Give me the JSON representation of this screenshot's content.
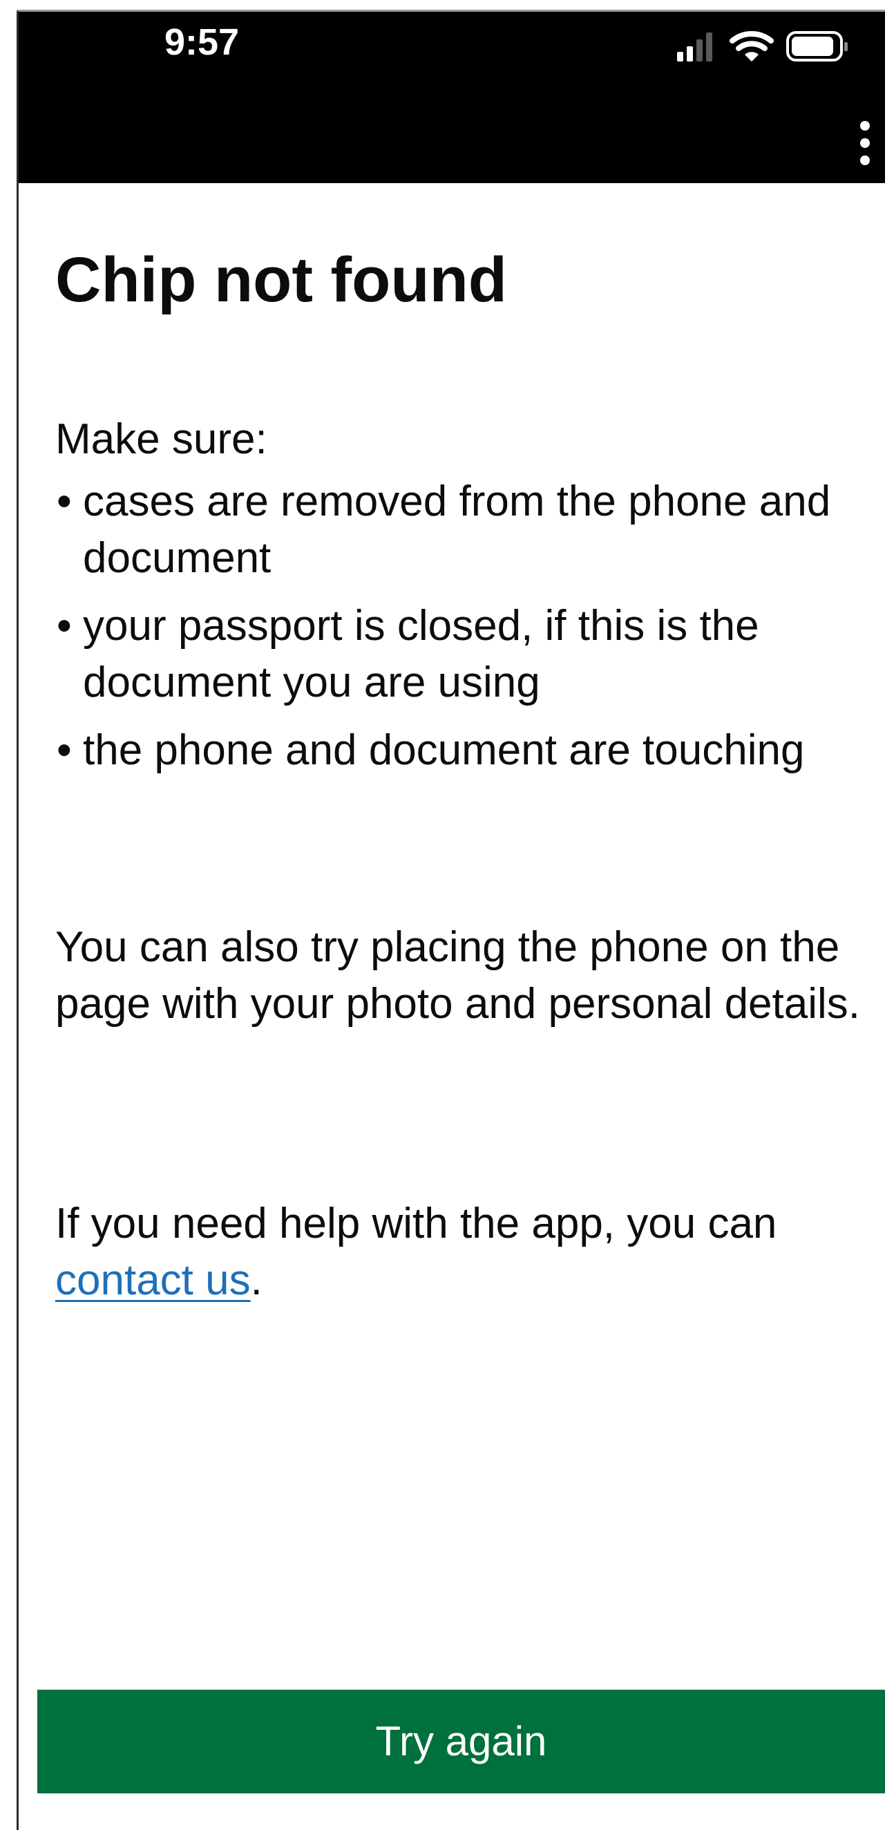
{
  "status_bar": {
    "time": "9:57"
  },
  "icons": {
    "signal": "cellular-signal-icon",
    "wifi": "wifi-icon",
    "battery": "battery-icon",
    "menu": "more-options-icon"
  },
  "page": {
    "title": "Chip not found",
    "intro": "Make sure:",
    "bullets": [
      "cases are removed from the phone and document",
      "your passport is closed, if this is the document you are using",
      "the phone and document are touching"
    ],
    "paragraph_1": "You can also try placing the phone on the page with your photo and personal details.",
    "help_text": "If you need help with the app, you can ",
    "help_link": "contact us",
    "help_end": "."
  },
  "actions": {
    "primary_label": "Try again"
  },
  "colors": {
    "header_bg": "#000000",
    "button_bg": "#00703c",
    "link": "#1d70b8",
    "text": "#0b0c0c"
  }
}
